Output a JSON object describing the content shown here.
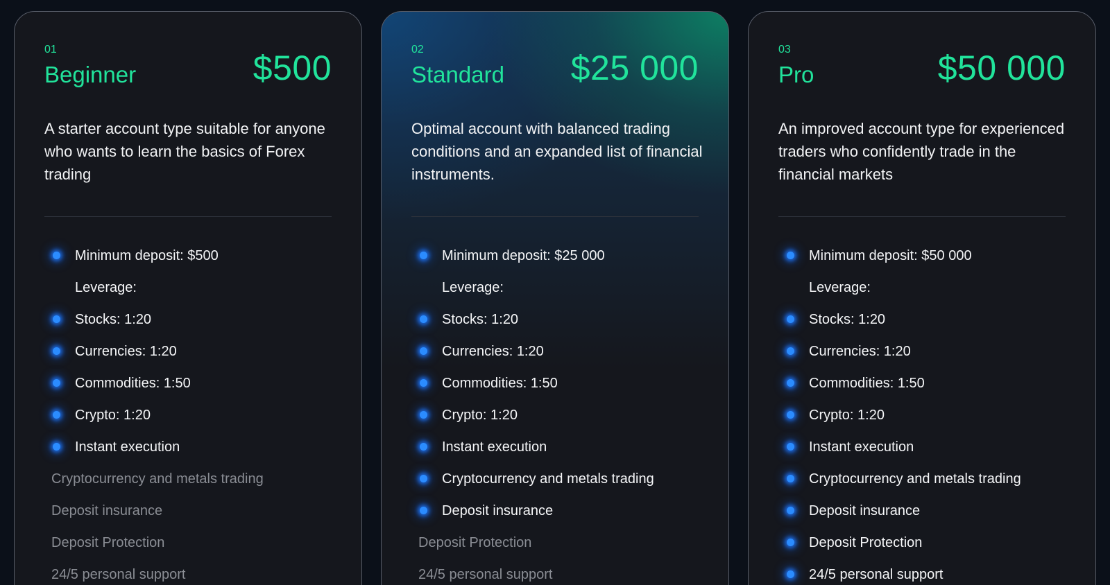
{
  "colors": {
    "accent": "#21e39b",
    "bullet": "#2b8cff",
    "text": "#f5f6f8",
    "muted": "#8a8d94",
    "card_bg": "#15171d",
    "page_bg": "#0b1019"
  },
  "plans": [
    {
      "number": "01",
      "name": "Beginner",
      "price": "$500",
      "description": "A starter account type suitable for anyone who wants to learn the basics of Forex trading",
      "features": [
        {
          "label": "Minimum deposit: $500",
          "included": true,
          "bullet": true
        },
        {
          "label": "Leverage:",
          "included": true,
          "bullet": false
        },
        {
          "label": "Stocks: 1:20",
          "included": true,
          "bullet": true
        },
        {
          "label": "Currencies: 1:20",
          "included": true,
          "bullet": true
        },
        {
          "label": "Commodities: 1:50",
          "included": true,
          "bullet": true
        },
        {
          "label": "Crypto: 1:20",
          "included": true,
          "bullet": true
        },
        {
          "label": "Instant execution",
          "included": true,
          "bullet": true
        },
        {
          "label": "Cryptocurrency and metals trading",
          "included": false,
          "bullet": false
        },
        {
          "label": "Deposit insurance",
          "included": false,
          "bullet": false
        },
        {
          "label": "Deposit Protection",
          "included": false,
          "bullet": false
        },
        {
          "label": "24/5 personal support",
          "included": false,
          "bullet": false
        }
      ]
    },
    {
      "number": "02",
      "name": "Standard",
      "price": "$25 000",
      "description": "Optimal account with balanced trading conditions and an expanded list of financial instruments.",
      "features": [
        {
          "label": "Minimum deposit: $25 000",
          "included": true,
          "bullet": true
        },
        {
          "label": "Leverage:",
          "included": true,
          "bullet": false
        },
        {
          "label": "Stocks: 1:20",
          "included": true,
          "bullet": true
        },
        {
          "label": "Currencies: 1:20",
          "included": true,
          "bullet": true
        },
        {
          "label": "Commodities: 1:50",
          "included": true,
          "bullet": true
        },
        {
          "label": "Crypto: 1:20",
          "included": true,
          "bullet": true
        },
        {
          "label": "Instant execution",
          "included": true,
          "bullet": true
        },
        {
          "label": "Cryptocurrency and metals trading",
          "included": true,
          "bullet": true
        },
        {
          "label": "Deposit insurance",
          "included": true,
          "bullet": true
        },
        {
          "label": "Deposit Protection",
          "included": false,
          "bullet": false
        },
        {
          "label": "24/5 personal support",
          "included": false,
          "bullet": false
        }
      ]
    },
    {
      "number": "03",
      "name": "Pro",
      "price": "$50 000",
      "description": "An improved account type for experienced traders who confidently trade in the financial markets",
      "features": [
        {
          "label": "Minimum deposit: $50 000",
          "included": true,
          "bullet": true
        },
        {
          "label": "Leverage:",
          "included": true,
          "bullet": false
        },
        {
          "label": "Stocks: 1:20",
          "included": true,
          "bullet": true
        },
        {
          "label": "Currencies: 1:20",
          "included": true,
          "bullet": true
        },
        {
          "label": "Commodities: 1:50",
          "included": true,
          "bullet": true
        },
        {
          "label": "Crypto: 1:20",
          "included": true,
          "bullet": true
        },
        {
          "label": "Instant execution",
          "included": true,
          "bullet": true
        },
        {
          "label": "Cryptocurrency and metals trading",
          "included": true,
          "bullet": true
        },
        {
          "label": "Deposit insurance",
          "included": true,
          "bullet": true
        },
        {
          "label": "Deposit Protection",
          "included": true,
          "bullet": true
        },
        {
          "label": "24/5 personal support",
          "included": true,
          "bullet": true
        }
      ]
    }
  ]
}
